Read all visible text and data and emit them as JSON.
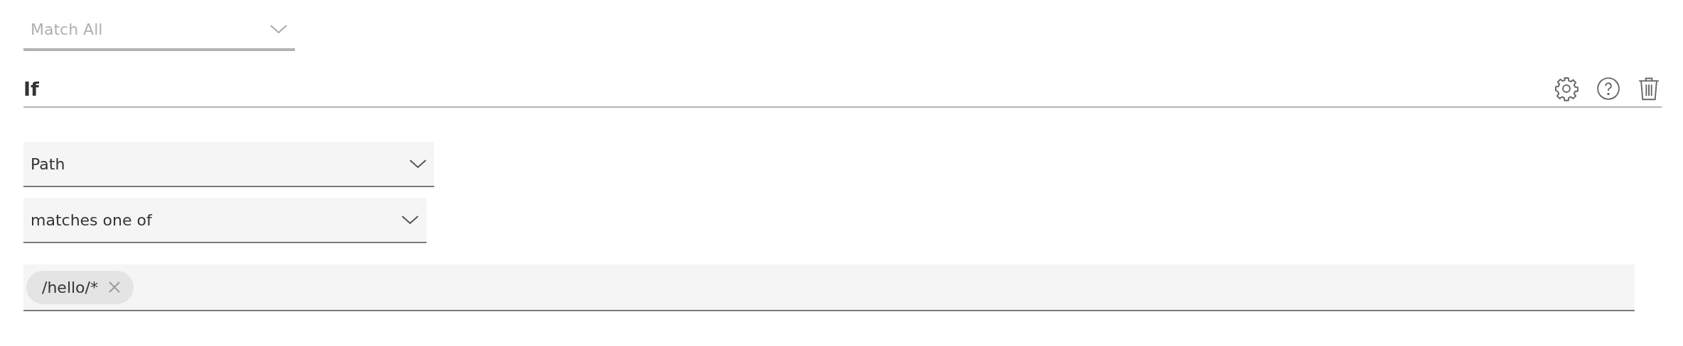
{
  "match_mode": {
    "value": "Match All",
    "disabled": true
  },
  "section": {
    "title": "If"
  },
  "condition": {
    "field": {
      "value": "Path",
      "disabled": false
    },
    "operator": {
      "value": "matches one of",
      "disabled": false
    }
  },
  "values": {
    "tags": [
      {
        "label": "/hello/*"
      }
    ]
  }
}
